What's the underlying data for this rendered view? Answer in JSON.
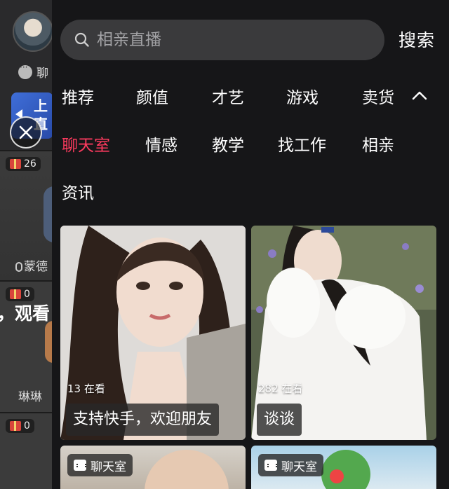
{
  "background": {
    "chat_label": "聊",
    "banner_text": "上\n直",
    "cards": [
      {
        "gift_count": "26",
        "name": "蒙德"
      },
      {
        "gift_count": "0",
        "name": "琳琳",
        "overlay_text": "，观看"
      },
      {
        "gift_count": "0"
      }
    ]
  },
  "search": {
    "placeholder": "相亲直播",
    "button_label": "搜索"
  },
  "categories": {
    "row1": [
      "推荐",
      "颜值",
      "才艺",
      "游戏",
      "卖货"
    ],
    "row2": [
      "聊天室",
      "情感",
      "教学",
      "找工作",
      "相亲"
    ],
    "row3": [
      "资讯"
    ],
    "active": "聊天室"
  },
  "colors": {
    "accent": "#ff3b5f",
    "panel_bg": "#161618",
    "search_bg": "#3a3a3c"
  },
  "streams": [
    {
      "viewers": "13 在看",
      "title": "支持快手，欢迎朋友"
    },
    {
      "viewers": "282 在看",
      "title": "谈谈"
    },
    {
      "tag": "聊天室"
    },
    {
      "tag": "聊天室"
    }
  ]
}
